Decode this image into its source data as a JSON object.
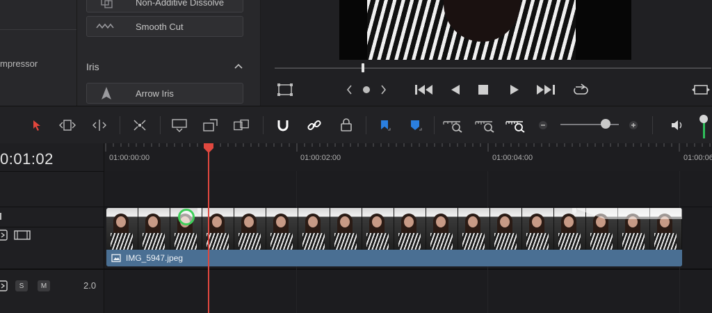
{
  "left_panel": {
    "item": "mpressor"
  },
  "effects": {
    "items": [
      {
        "label": "Non-Additive Dissolve",
        "icon": "dissolve-icon"
      },
      {
        "label": "Smooth Cut",
        "icon": "wave-icon"
      }
    ],
    "section_title": "Iris",
    "iris_items": [
      {
        "label": "Arrow Iris",
        "icon": "arrow-iris-icon"
      }
    ]
  },
  "timeline": {
    "timecode": "0:01:02",
    "ruler_labels": [
      "01:00:00:00",
      "01:00:02:00",
      "01:00:04:00",
      "01:00:06"
    ],
    "clip": {
      "name": "IMG_5947.jpeg"
    },
    "audio_track": {
      "solo_label": "S",
      "mute_label": "M",
      "volume": "2.0"
    }
  },
  "colors": {
    "playhead": "#e0483f",
    "clip": "#4a6f93",
    "marker": "#2a7fe0",
    "flag": "#2a7fe0",
    "tool_selected": "#e2463c"
  }
}
